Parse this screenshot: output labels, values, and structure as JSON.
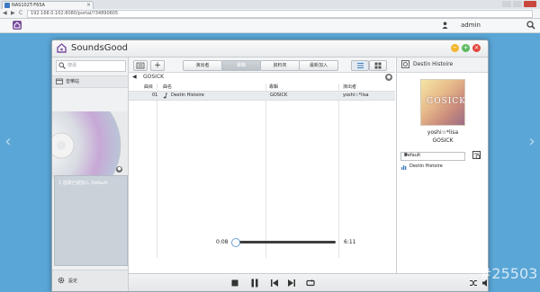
{
  "browser": {
    "tab_title": "NAS102T-F65A",
    "url": "192.168.0.102:8080/portal/?34890605",
    "close_glyph": "×",
    "nav_back": "◀",
    "nav_forward": "▶",
    "nav_reload": "C"
  },
  "nas": {
    "user": "admin"
  },
  "app": {
    "title": "SoundsGood",
    "window_buttons": {
      "minimize": "−",
      "maximize": "+",
      "close": "×"
    }
  },
  "sidebar": {
    "search_placeholder": "搜尋",
    "station_label": "音樂站",
    "queue_text": "1 首歌已經加入 Default",
    "settings_label": "設定",
    "panel_circle": "●"
  },
  "toolbar": {
    "add_glyph": "+",
    "tabs": [
      "演出者",
      "專輯",
      "資料夾",
      "最新加入"
    ],
    "active_tab": 1
  },
  "breadcrumb": {
    "back": "◀",
    "path": "GOSICK",
    "circle": "●"
  },
  "table": {
    "headers": [
      "曲目",
      "曲名",
      "專輯",
      "演出者"
    ],
    "rows": [
      {
        "track": "01",
        "title": "Destin Histoire",
        "album": "GOSICK",
        "artist": "yoshi☆*lisa"
      }
    ]
  },
  "now_playing": {
    "title": "Destin Histoire",
    "album_art_text": "GOSICK",
    "artist": "yoshi☆*lisa",
    "album": "GOSICK"
  },
  "playlist": {
    "selected": "Default",
    "dropdown_glyph": "▼",
    "items": [
      "Destin Histoire"
    ]
  },
  "player": {
    "elapsed": "0:08",
    "duration": "6:11",
    "progress": 0.02
  },
  "watermark": "#25503",
  "colors": {
    "accent": "#7b4f9e",
    "desktop": "#5aa6d6",
    "minimize": "#f2b62b",
    "maximize": "#5cb85c",
    "close": "#e2453c"
  }
}
